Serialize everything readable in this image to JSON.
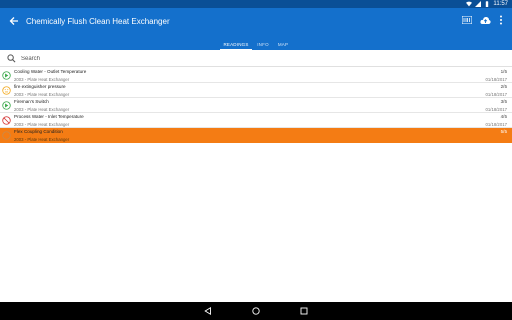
{
  "status_bar": {
    "time": "11:57",
    "icons": [
      "wifi-icon",
      "signal-icon",
      "battery-icon"
    ]
  },
  "app_bar": {
    "title": "Chemically Flush Clean Heat Exchanger",
    "back_icon": "arrow-back-icon",
    "actions": [
      "barcode-icon",
      "cloud-upload-icon",
      "more-vert-icon"
    ]
  },
  "tabs": [
    {
      "label": "READINGS",
      "active": true
    },
    {
      "label": "INFO",
      "active": false
    },
    {
      "label": "MAP",
      "active": false
    }
  ],
  "search": {
    "placeholder": "Search",
    "value": ""
  },
  "readings": [
    {
      "title": "Cooling Water - Outlet Temperature",
      "subtitle": "2003 - Plate Heat Exchanger",
      "count": "1/5",
      "date": "01/18/2017",
      "status": "ok",
      "icon": "check-circle-icon"
    },
    {
      "title": "fire extinguisher pressure",
      "subtitle": "2003 - Plate Heat Exchanger",
      "count": "2/5",
      "date": "01/18/2017",
      "status": "warning",
      "icon": "warning-face-icon"
    },
    {
      "title": "Fireman's Switch",
      "subtitle": "2003 - Plate Heat Exchanger",
      "count": "3/5",
      "date": "01/18/2017",
      "status": "ok",
      "icon": "check-circle-icon"
    },
    {
      "title": "Process Water - Inlet Temperature",
      "subtitle": "2003 - Plate Heat Exchanger",
      "count": "4/5",
      "date": "01/18/2017",
      "status": "error",
      "icon": "blocked-circle-icon"
    },
    {
      "title": "Flex Coupling Condition",
      "subtitle": "2003 - Plate Heat Exchanger",
      "count": "5/5",
      "date": "",
      "status": "selected",
      "icon": "empty-circle-icon"
    }
  ],
  "colors": {
    "primary": "#1470cc",
    "status_bar": "#0a4f96",
    "selected": "#f47c14",
    "ok": "#3aa94a",
    "warning": "#f2a81c",
    "error": "#d32f2f"
  },
  "nav_bar": {
    "icons": [
      "nav-back-icon",
      "nav-home-icon",
      "nav-recents-icon"
    ]
  }
}
